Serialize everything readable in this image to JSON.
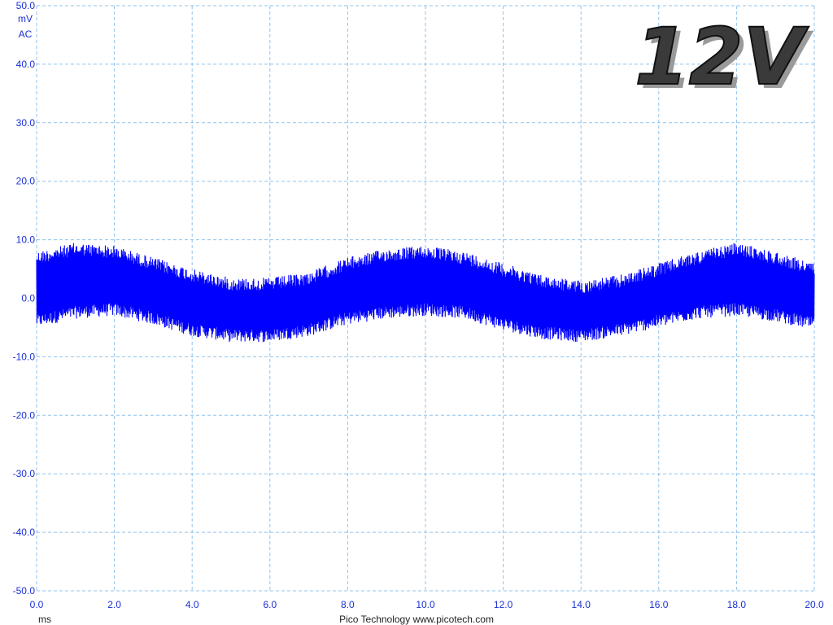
{
  "chart_data": {
    "type": "line",
    "title": "",
    "xlabel": "",
    "ylabel": "",
    "y_unit": "mV",
    "y_coupling": "AC",
    "x_unit": "ms",
    "xlim": [
      0,
      20
    ],
    "ylim": [
      -50,
      50
    ],
    "x_ticks": [
      "0.0",
      "2.0",
      "4.0",
      "6.0",
      "8.0",
      "10.0",
      "12.0",
      "14.0",
      "16.0",
      "18.0",
      "20.0"
    ],
    "y_ticks": [
      "50.0",
      "40.0",
      "30.0",
      "20.0",
      "10.0",
      "0.0",
      "-10.0",
      "-20.0",
      "-30.0",
      "-40.0",
      "-50.0"
    ],
    "grid": true,
    "series": [
      {
        "color": "#0000ff",
        "description_level": "dense ripple waveform",
        "envelope_x": [
          0,
          1,
          2,
          3,
          4,
          5,
          6,
          7,
          8,
          9,
          10,
          11,
          12,
          13,
          14,
          15,
          16,
          17,
          18,
          19,
          20
        ],
        "envelope_upper": [
          8.0,
          9.5,
          9.0,
          7.0,
          5.0,
          3.5,
          3.5,
          4.5,
          7.0,
          8.5,
          9.0,
          8.0,
          6.0,
          4.0,
          3.0,
          4.0,
          6.0,
          8.0,
          9.5,
          8.0,
          6.0
        ],
        "envelope_lower": [
          -5.0,
          -3.5,
          -3.0,
          -4.5,
          -6.5,
          -7.5,
          -7.5,
          -6.5,
          -4.5,
          -3.5,
          -3.0,
          -3.5,
          -5.5,
          -7.0,
          -7.5,
          -6.5,
          -5.0,
          -3.5,
          -3.0,
          -4.0,
          -5.5
        ]
      }
    ]
  },
  "badge": {
    "text": "12V"
  },
  "footer": {
    "credit": "Pico Technology  www.picotech.com"
  },
  "colors": {
    "trace": "#0000ff",
    "axis_text": "#1a2fd6",
    "grid": "#8fc3ee"
  }
}
